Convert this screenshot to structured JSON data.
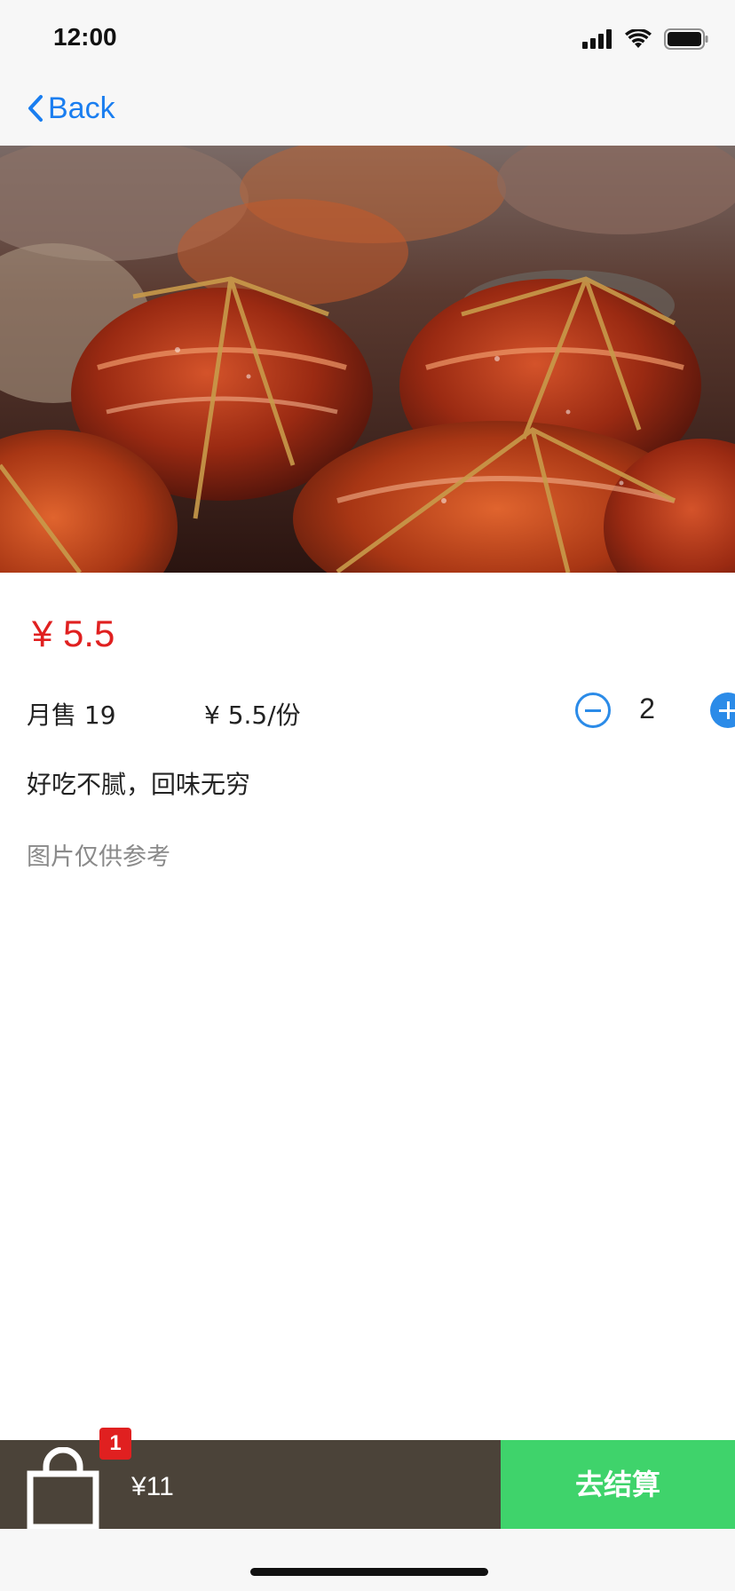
{
  "status_bar": {
    "time": "12:00",
    "icons": [
      "cellular-signal-icon",
      "wifi-icon",
      "battery-icon"
    ]
  },
  "nav": {
    "back_label": "Back",
    "accent_color": "#1a7ef0"
  },
  "product": {
    "image_icon": "food-photo",
    "price": "¥  5.5",
    "monthly_sales": "月售 19",
    "unit_price": "¥  5.5/份",
    "quantity": "2",
    "description": "好吃不腻，回味无穷",
    "disclaimer": "图片仅供参考",
    "price_color": "#e02020",
    "stepper_color": "#2b8be8"
  },
  "cart": {
    "icon": "shopping-bag-icon",
    "badge_count": "1",
    "total": "¥11",
    "checkout_label": "去结算",
    "bar_color": "#4b4339",
    "checkout_color": "#3fd36b",
    "badge_color": "#e02020"
  }
}
